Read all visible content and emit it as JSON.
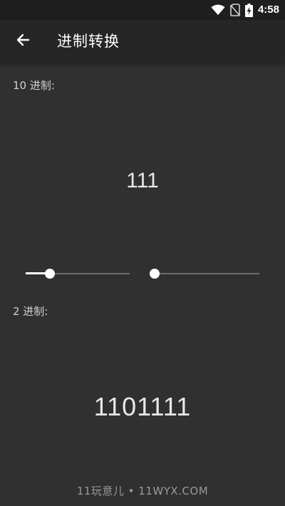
{
  "status_bar": {
    "time": "4:58",
    "icons": [
      "wifi-icon",
      "no-sim-icon",
      "battery-charging-icon"
    ]
  },
  "app_bar": {
    "title": "进制转换",
    "back_icon": "arrow-left-icon"
  },
  "decimal": {
    "label": "10 进制:",
    "value": "111"
  },
  "sliders": {
    "left": {
      "level_percent": 23
    },
    "right": {
      "level_percent": 0
    },
    "accent_color": "#ffffff"
  },
  "binary": {
    "label": "2 进制:",
    "value": "1101111"
  },
  "watermark": "11玩意儿 • 11WYX.COM",
  "colors": {
    "background": "#303030",
    "app_bar": "#262626",
    "status_bar": "#1f1f1f",
    "text": "#e8e8e8"
  }
}
